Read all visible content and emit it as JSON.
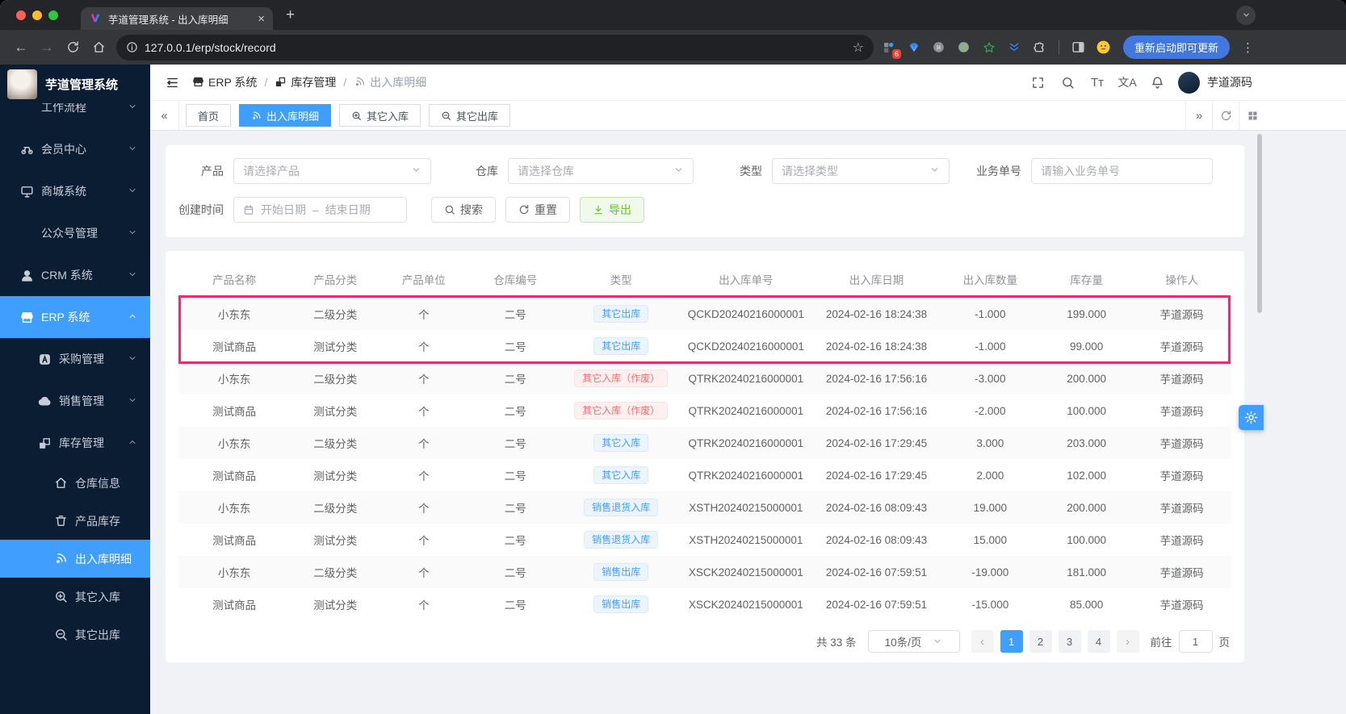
{
  "icons": {
    "plus": "+",
    "close": "×",
    "chev_double_left": "«",
    "chev_double_right": "»",
    "prev": "‹",
    "next": "›",
    "dots": "⋮",
    "star": "☆",
    "back": "←",
    "forward": "→",
    "cmd": "⌘"
  },
  "colors": {
    "accent": "#409eff",
    "highlight_border": "#ef2b70",
    "badge_blue": "#409eff",
    "badge_red": "#f56c6c",
    "export_green": "#67c23a",
    "sidebar_bg": "#0b1d32"
  },
  "browser": {
    "tab_title": "芋道管理系统 - 出入库明细",
    "url": "127.0.0.1/erp/stock/record",
    "extension_badge": "6",
    "update_button": "重新启动即可更新"
  },
  "sidebar": {
    "app_title": "芋道管理系统",
    "items": [
      {
        "label": "工作流程"
      },
      {
        "label": "会员中心"
      },
      {
        "label": "商城系统"
      },
      {
        "label": "公众号管理"
      },
      {
        "label": "CRM 系统"
      },
      {
        "label": "ERP 系统"
      }
    ],
    "erp_children": [
      {
        "label": "采购管理"
      },
      {
        "label": "销售管理"
      },
      {
        "label": "库存管理"
      }
    ],
    "stock_children": [
      {
        "label": "仓库信息"
      },
      {
        "label": "产品库存"
      },
      {
        "label": "出入库明细"
      },
      {
        "label": "其它入库"
      },
      {
        "label": "其它出库"
      }
    ]
  },
  "header": {
    "breadcrumb": [
      "ERP 系统",
      "库存管理",
      "出入库明细"
    ],
    "sep": "/",
    "fontsize_icon": "Tт",
    "lang_icon": "文A",
    "username": "芋道源码"
  },
  "tabs": [
    {
      "label": "首页"
    },
    {
      "label": "出入库明细"
    },
    {
      "label": "其它入库"
    },
    {
      "label": "其它出库"
    }
  ],
  "filters": {
    "product_label": "产品",
    "product_placeholder": "请选择产品",
    "warehouse_label": "仓库",
    "warehouse_placeholder": "请选择仓库",
    "type_label": "类型",
    "type_placeholder": "请选择类型",
    "bizno_label": "业务单号",
    "bizno_placeholder": "请输入业务单号",
    "date_label": "创建时间",
    "date_start": "开始日期",
    "date_sep": "–",
    "date_end": "结束日期",
    "search": "搜索",
    "reset": "重置",
    "export": "导出"
  },
  "table": {
    "columns": [
      "产品名称",
      "产品分类",
      "产品单位",
      "仓库编号",
      "类型",
      "出入库单号",
      "出入库日期",
      "出入库数量",
      "库存量",
      "操作人"
    ],
    "rows": [
      {
        "name": "小东东",
        "cat": "二级分类",
        "unit": "个",
        "wh": "二号",
        "type": "其它出库",
        "badge": "badge b-blue",
        "no": "QCKD20240216000001",
        "date": "2024-02-16 18:24:38",
        "qty": "-1.000",
        "stock": "199.000",
        "op": "芋道源码"
      },
      {
        "name": "测试商品",
        "cat": "测试分类",
        "unit": "个",
        "wh": "二号",
        "type": "其它出库",
        "badge": "badge b-blue",
        "no": "QCKD20240216000001",
        "date": "2024-02-16 18:24:38",
        "qty": "-1.000",
        "stock": "99.000",
        "op": "芋道源码"
      },
      {
        "name": "小东东",
        "cat": "二级分类",
        "unit": "个",
        "wh": "二号",
        "type": "其它入库（作废）",
        "badge": "badge b-red",
        "no": "QTRK20240216000001",
        "date": "2024-02-16 17:56:16",
        "qty": "-3.000",
        "stock": "200.000",
        "op": "芋道源码"
      },
      {
        "name": "测试商品",
        "cat": "测试分类",
        "unit": "个",
        "wh": "二号",
        "type": "其它入库（作废）",
        "badge": "badge b-red",
        "no": "QTRK20240216000001",
        "date": "2024-02-16 17:56:16",
        "qty": "-2.000",
        "stock": "100.000",
        "op": "芋道源码"
      },
      {
        "name": "小东东",
        "cat": "二级分类",
        "unit": "个",
        "wh": "二号",
        "type": "其它入库",
        "badge": "badge b-blue",
        "no": "QTRK20240216000001",
        "date": "2024-02-16 17:29:45",
        "qty": "3.000",
        "stock": "203.000",
        "op": "芋道源码"
      },
      {
        "name": "测试商品",
        "cat": "测试分类",
        "unit": "个",
        "wh": "二号",
        "type": "其它入库",
        "badge": "badge b-blue",
        "no": "QTRK20240216000001",
        "date": "2024-02-16 17:29:45",
        "qty": "2.000",
        "stock": "102.000",
        "op": "芋道源码"
      },
      {
        "name": "小东东",
        "cat": "二级分类",
        "unit": "个",
        "wh": "二号",
        "type": "销售退货入库",
        "badge": "badge b-blue",
        "no": "XSTH20240215000001",
        "date": "2024-02-16 08:09:43",
        "qty": "19.000",
        "stock": "200.000",
        "op": "芋道源码"
      },
      {
        "name": "测试商品",
        "cat": "测试分类",
        "unit": "个",
        "wh": "二号",
        "type": "销售退货入库",
        "badge": "badge b-blue",
        "no": "XSTH20240215000001",
        "date": "2024-02-16 08:09:43",
        "qty": "15.000",
        "stock": "100.000",
        "op": "芋道源码"
      },
      {
        "name": "小东东",
        "cat": "二级分类",
        "unit": "个",
        "wh": "二号",
        "type": "销售出库",
        "badge": "badge b-blue",
        "no": "XSCK20240215000001",
        "date": "2024-02-16 07:59:51",
        "qty": "-19.000",
        "stock": "181.000",
        "op": "芋道源码"
      },
      {
        "name": "测试商品",
        "cat": "测试分类",
        "unit": "个",
        "wh": "二号",
        "type": "销售出库",
        "badge": "badge b-blue",
        "no": "XSCK20240215000001",
        "date": "2024-02-16 07:59:51",
        "qty": "-15.000",
        "stock": "85.000",
        "op": "芋道源码"
      }
    ]
  },
  "pagination": {
    "total": "共 33 条",
    "page_size": "10条/页",
    "pages": [
      "1",
      "2",
      "3",
      "4"
    ],
    "goto_label": "前往",
    "goto_value": "1",
    "page_unit": "页"
  }
}
